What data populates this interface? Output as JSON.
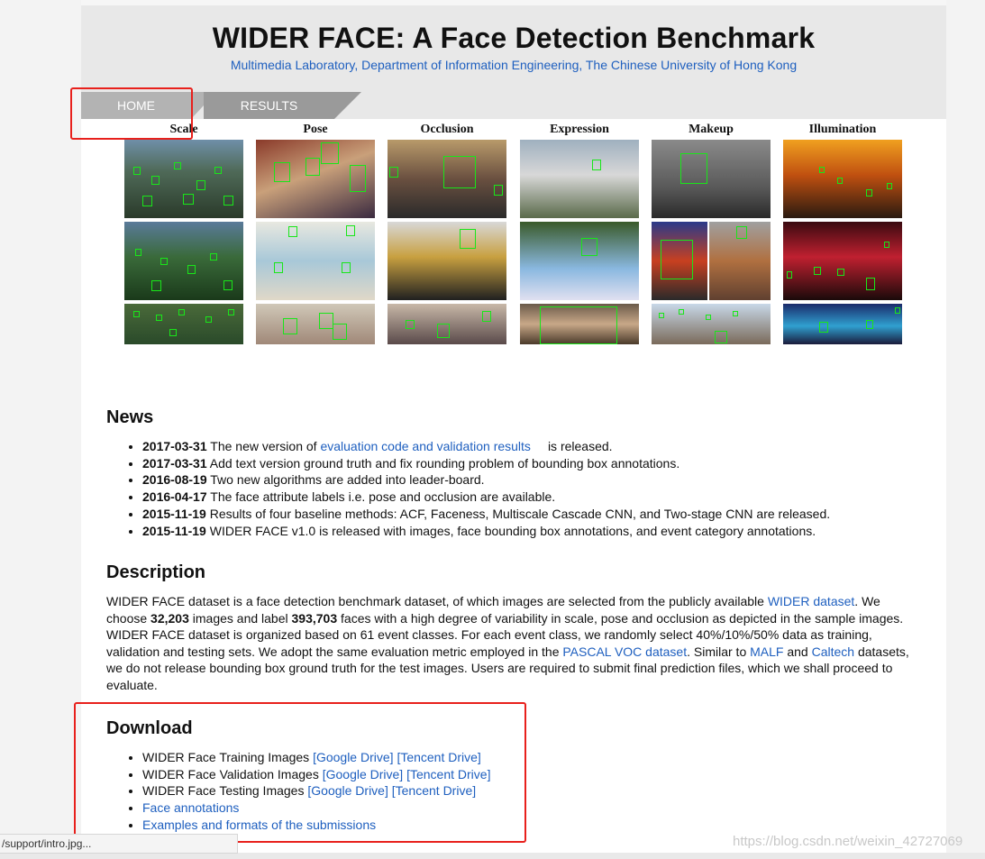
{
  "header": {
    "title": "WIDER FACE: A Face Detection Benchmark",
    "subtitle": "Multimedia Laboratory, Department of Information Engineering, The Chinese University of Hong Kong"
  },
  "nav": {
    "home": "HOME",
    "results": "RESULTS"
  },
  "categories": [
    "Scale",
    "Pose",
    "Occlusion",
    "Expression",
    "Makeup",
    "Illumination"
  ],
  "news": {
    "heading": "News",
    "items": [
      {
        "date": "2017-03-31",
        "pre": "The new version of ",
        "link": "evaluation code and validation results",
        "post": "is released."
      },
      {
        "date": "2017-03-31",
        "text": "Add text version ground truth and fix rounding problem of bounding box annotations."
      },
      {
        "date": "2016-08-19",
        "text": "Two new algorithms are added into leader-board."
      },
      {
        "date": "2016-04-17",
        "text": "The face attribute labels i.e. pose and occlusion are available."
      },
      {
        "date": "2015-11-19",
        "text": "Results of four baseline methods: ACF, Faceness, Multiscale Cascade CNN, and Two-stage CNN are released."
      },
      {
        "date": "2015-11-19",
        "text": "WIDER FACE v1.0 is released with images, face bounding box annotations, and event category annotations."
      }
    ]
  },
  "description": {
    "heading": "Description",
    "p1": "WIDER FACE dataset is a face detection benchmark dataset, of which images are selected from the publicly available ",
    "link_wider": "WIDER dataset",
    "p2": ". We choose ",
    "images_count": "32,203",
    "p3": " images and label ",
    "faces_count": "393,703",
    "p4": " faces with a high degree of variability in scale, pose and occlusion as depicted in the sample images. WIDER FACE dataset is organized based on 61 event classes. For each event class, we randomly select 40%/10%/50% data as training, validation and testing sets. We adopt the same evaluation metric employed in the ",
    "link_pascal": "PASCAL VOC dataset",
    "p5": ". Similar to ",
    "link_malf": "MALF",
    "p6": " and ",
    "link_caltech": "Caltech",
    "p7": " datasets, we do not release bounding box ground truth for the test images. Users are required to submit final prediction files, which we shall proceed to evaluate."
  },
  "download": {
    "heading": "Download",
    "items": [
      {
        "text": "WIDER Face Training Images ",
        "links": [
          "[Google Drive]",
          "[Tencent Drive]"
        ]
      },
      {
        "text": "WIDER Face Validation Images ",
        "links": [
          "[Google Drive]",
          "[Tencent Drive]"
        ]
      },
      {
        "text": "WIDER Face Testing Images ",
        "links": [
          "[Google Drive]",
          "[Tencent Drive]"
        ]
      },
      {
        "text": "",
        "links": [
          "Face annotations"
        ]
      },
      {
        "text": "",
        "links": [
          "Examples and formats of the submissions"
        ]
      }
    ]
  },
  "statusbar": {
    "url": "/support/intro.jpg..."
  },
  "watermark": "https://blog.csdn.net/weixin_42727069",
  "colors": {
    "link": "#1e5fbf",
    "highlight_box": "#e8201c",
    "face_box": "#19e619"
  }
}
